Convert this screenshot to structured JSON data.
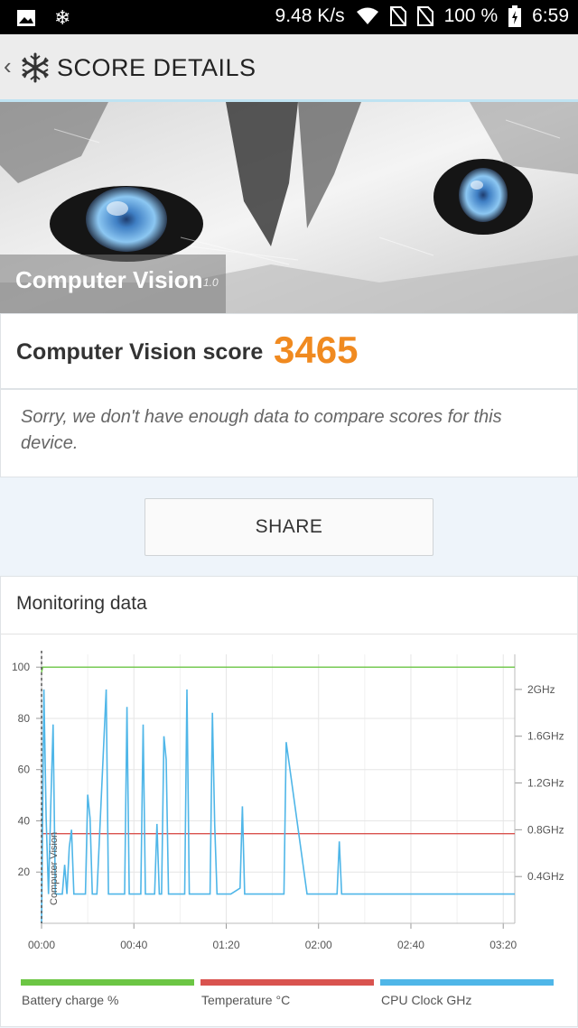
{
  "status_bar": {
    "network_speed": "9.48 K/s",
    "battery": "100 %",
    "time": "6:59",
    "icons": [
      "image-icon",
      "snowflake-icon",
      "wifi-icon",
      "no-sim-icon",
      "no-sim-icon",
      "battery-charging-icon"
    ]
  },
  "app_bar": {
    "title": "SCORE DETAILS"
  },
  "hero": {
    "test_name": "Computer Vision",
    "version": "1.0"
  },
  "score": {
    "label": "Computer Vision score",
    "value": "3465",
    "value_color": "#f08a20"
  },
  "message": "Sorry, we don't have enough data to compare scores for this device.",
  "share_label": "SHARE",
  "monitoring": {
    "title": "Monitoring data"
  },
  "chart_data": {
    "type": "line",
    "x_ticks": [
      "00:00",
      "00:40",
      "01:20",
      "02:00",
      "02:40",
      "03:20"
    ],
    "y_left_ticks": [
      "100",
      "80",
      "60",
      "40",
      "20"
    ],
    "y_right_ticks": [
      "2GHz",
      "1.6GHz",
      "1.2GHz",
      "0.8GHz",
      "0.4GHz"
    ],
    "ylim_left": [
      0,
      105
    ],
    "ylim_right_ghz": [
      0,
      2.3
    ],
    "xlim_seconds": [
      0,
      205
    ],
    "annotation": "Computer Vision",
    "grid": true,
    "legend_position": "bottom",
    "series": [
      {
        "name": "Battery charge %",
        "axis": "left",
        "color": "#6cc644",
        "x": [
          0,
          0.5,
          205
        ],
        "y": [
          98,
          100,
          100
        ]
      },
      {
        "name": "Temperature °C",
        "axis": "left",
        "color": "#d9534f",
        "x": [
          0,
          0.5,
          205
        ],
        "y": [
          35,
          35,
          35
        ]
      },
      {
        "name": "CPU Clock GHz",
        "axis": "right",
        "color": "#4fb6e8",
        "x": [
          0,
          1,
          2,
          3,
          4,
          5,
          6,
          7,
          8,
          9,
          10,
          11,
          12,
          13,
          14,
          16,
          19,
          20,
          21,
          22,
          24,
          28,
          29,
          30,
          31,
          34,
          36,
          37,
          38,
          42,
          43,
          44,
          45,
          48,
          49,
          50,
          51,
          52,
          53,
          54,
          55,
          59,
          60,
          61,
          62,
          63,
          64,
          65,
          66,
          67,
          68,
          70,
          71,
          72,
          73,
          74,
          75,
          76,
          77,
          79,
          80,
          81,
          82,
          86,
          87,
          88,
          90,
          91,
          98,
          99,
          100,
          101,
          102,
          104,
          105,
          106,
          115,
          116,
          117,
          118,
          123,
          124,
          125,
          127,
          128,
          129,
          130,
          131,
          134,
          146,
          147,
          148,
          150,
          151,
          152,
          153,
          155,
          160,
          161,
          162,
          163,
          164,
          166,
          167,
          168,
          169,
          170,
          171,
          172,
          174,
          175,
          176,
          177,
          180,
          181,
          182,
          183,
          184,
          185,
          186,
          188,
          189,
          190,
          194,
          195,
          196,
          200,
          201,
          205
        ],
        "y": [
          0.0,
          2.0,
          0.9,
          0.25,
          1.0,
          1.7,
          0.25,
          0.25,
          0.25,
          0.25,
          0.5,
          0.25,
          0.65,
          0.8,
          0.25,
          0.25,
          0.25,
          1.1,
          0.9,
          0.25,
          0.25,
          2.0,
          0.25,
          0.25,
          0.25,
          0.25,
          0.25,
          1.85,
          0.25,
          0.25,
          0.25,
          1.7,
          0.25,
          0.25,
          0.25,
          0.85,
          0.25,
          0.25,
          1.6,
          1.4,
          0.25,
          0.25,
          0.25,
          0.25,
          0.25,
          2.0,
          0.25,
          0.25,
          0.25,
          0.25,
          0.25,
          0.25,
          0.25,
          0.25,
          0.25,
          1.8,
          0.85,
          0.25,
          0.25,
          0.25,
          0.25,
          0.25,
          0.25,
          0.3,
          1.0,
          0.25,
          0.25,
          0.25,
          0.25,
          0.25,
          0.25,
          0.25,
          0.25,
          0.25,
          0.25,
          1.55,
          0.25,
          0.25,
          0.25,
          0.25,
          0.25,
          0.25,
          0.25,
          0.25,
          0.25,
          0.7,
          0.25,
          0.25,
          0.25,
          0.25,
          0.25,
          0.25,
          0.25,
          0.25,
          0.25,
          0.25,
          0.25,
          0.25,
          0.25,
          0.25,
          0.25,
          0.25,
          0.25,
          0.25,
          0.25,
          0.25,
          0.25,
          0.25,
          0.25,
          0.25,
          0.25,
          0.25,
          0.25,
          0.25,
          0.25,
          0.25,
          0.25,
          0.25,
          0.25,
          0.25,
          0.25,
          0.25,
          0.25,
          0.25,
          0.25,
          0.25,
          0.25,
          0.25,
          0.25
        ]
      }
    ]
  }
}
